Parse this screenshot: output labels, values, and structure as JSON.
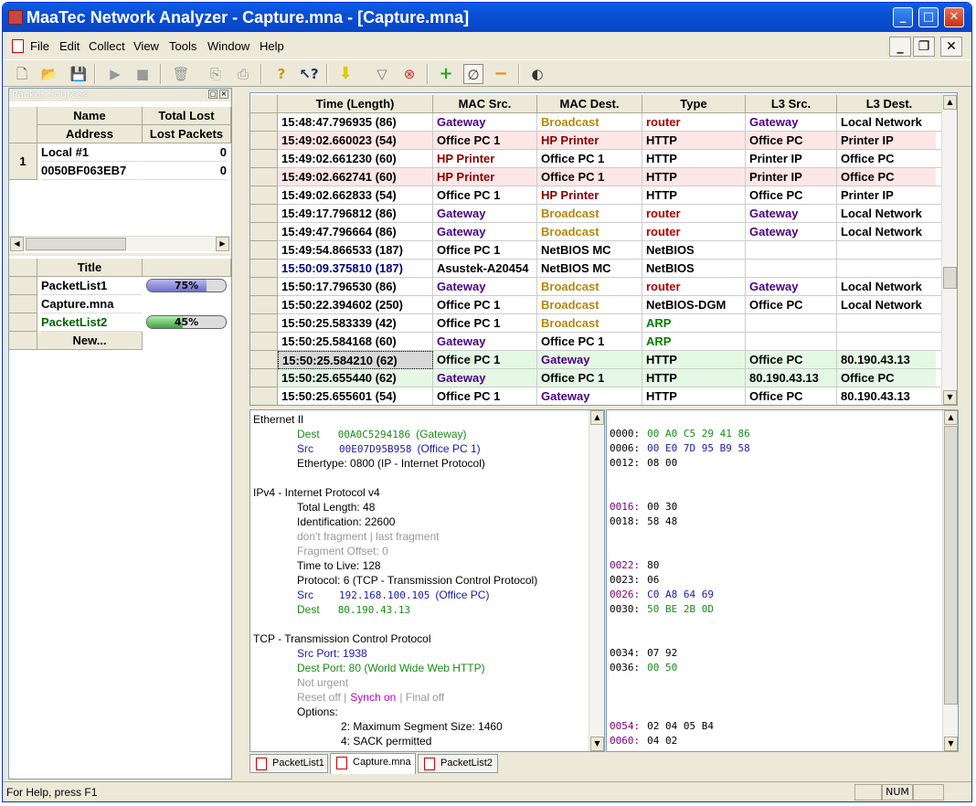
{
  "window": {
    "title": "MaaTec Network Analyzer - Capture.mna - [Capture.mna]"
  },
  "menu": [
    "File",
    "Edit",
    "Collect",
    "View",
    "Tools",
    "Window",
    "Help"
  ],
  "packet_sources": {
    "title": "Packet Sources",
    "headers": {
      "name": "Name",
      "total_lost": "Total Lost",
      "address": "Address",
      "lost_packets": "Lost Packets"
    },
    "row_number": "1",
    "name": "Local #1",
    "total_lost": "0",
    "address": "0050BF063EB7",
    "lost_packets": "0"
  },
  "lists": {
    "header": "Title",
    "items": [
      {
        "title": "PacketList1",
        "percent": "75%",
        "progress": 0.75,
        "color": "#000000"
      },
      {
        "title": "Capture.mna",
        "percent": "",
        "progress": null,
        "color": "#000000"
      },
      {
        "title": "PacketList2",
        "percent": "45%",
        "progress": 0.45,
        "color": "#006400"
      }
    ],
    "new_label": "New..."
  },
  "packet_table": {
    "headers": [
      "Time  (Length)",
      "MAC Src.",
      "MAC Dest.",
      "Type",
      "L3 Src.",
      "L3 Dest."
    ],
    "rows": [
      {
        "time": "15:48:47.796935  (86)",
        "mac_src": "Gateway",
        "mac_dst": "Broadcast",
        "type": "router",
        "l3_src": "Gateway",
        "l3_dst": "Local Network",
        "bg": "#ffffff"
      },
      {
        "time": "15:49:02.660023  (54)",
        "mac_src": "Office PC 1",
        "mac_dst": "HP Printer",
        "type": "HTTP",
        "l3_src": "Office PC",
        "l3_dst": "Printer IP",
        "bg": "#fde6e6"
      },
      {
        "time": "15:49:02.661230  (60)",
        "mac_src": "HP Printer",
        "mac_dst": "Office PC 1",
        "type": "HTTP",
        "l3_src": "Printer IP",
        "l3_dst": "Office PC",
        "bg": "#ffffff"
      },
      {
        "time": "15:49:02.662741  (60)",
        "mac_src": "HP Printer",
        "mac_dst": "Office PC 1",
        "type": "HTTP",
        "l3_src": "Printer IP",
        "l3_dst": "Office PC",
        "bg": "#fde6e6"
      },
      {
        "time": "15:49:02.662833  (54)",
        "mac_src": "Office PC 1",
        "mac_dst": "HP Printer",
        "type": "HTTP",
        "l3_src": "Office PC",
        "l3_dst": "Printer IP",
        "bg": "#ffffff"
      },
      {
        "time": "15:49:17.796812  (86)",
        "mac_src": "Gateway",
        "mac_dst": "Broadcast",
        "type": "router",
        "l3_src": "Gateway",
        "l3_dst": "Local Network",
        "bg": "#ffffff"
      },
      {
        "time": "15:49:47.796664  (86)",
        "mac_src": "Gateway",
        "mac_dst": "Broadcast",
        "type": "router",
        "l3_src": "Gateway",
        "l3_dst": "Local Network",
        "bg": "#ffffff"
      },
      {
        "time": "15:49:54.866533  (187)",
        "mac_src": "Office PC 1",
        "mac_dst": "NetBIOS MC",
        "type": "NetBIOS",
        "l3_src": "",
        "l3_dst": "",
        "bg": "#ffffff"
      },
      {
        "time": "15:50:09.375810  (187)",
        "mac_src": "Asustek-A20454",
        "mac_dst": "NetBIOS MC",
        "type": "NetBIOS",
        "l3_src": "",
        "l3_dst": "",
        "bg": "#ffffff"
      },
      {
        "time": "15:50:17.796530  (86)",
        "mac_src": "Gateway",
        "mac_dst": "Broadcast",
        "type": "router",
        "l3_src": "Gateway",
        "l3_dst": "Local Network",
        "bg": "#ffffff"
      },
      {
        "time": "15:50:22.394602  (250)",
        "mac_src": "Office PC 1",
        "mac_dst": "Broadcast",
        "type": "NetBIOS-DGM",
        "l3_src": "Office PC",
        "l3_dst": "Local Network",
        "bg": "#ffffff"
      },
      {
        "time": "15:50:25.583339  (42)",
        "mac_src": "Office PC 1",
        "mac_dst": "Broadcast",
        "type": "ARP",
        "l3_src": "",
        "l3_dst": "",
        "bg": "#ffffff"
      },
      {
        "time": "15:50:25.584168  (60)",
        "mac_src": "Gateway",
        "mac_dst": "Office PC 1",
        "type": "ARP",
        "l3_src": "",
        "l3_dst": "",
        "bg": "#ffffff"
      },
      {
        "time": "15:50:25.584210  (62)",
        "mac_src": "Office PC 1",
        "mac_dst": "Gateway",
        "type": "HTTP",
        "l3_src": "Office PC",
        "l3_dst": "80.190.43.13",
        "bg": "#e4f8e4"
      },
      {
        "time": "15:50:25.655440  (62)",
        "mac_src": "Gateway",
        "mac_dst": "Office PC 1",
        "type": "HTTP",
        "l3_src": "80.190.43.13",
        "l3_dst": "Office PC",
        "bg": "#e4f8e4"
      },
      {
        "time": "15:50:25.655601  (54)",
        "mac_src": "Office PC 1",
        "mac_dst": "Gateway",
        "type": "HTTP",
        "l3_src": "Office PC",
        "l3_dst": "80.190.43.13",
        "bg": "#ffffff"
      }
    ]
  },
  "colors": {
    "gateway": "#4b0082",
    "broadcast": "#b8860b",
    "router": "#b00000",
    "hp_printer": "#8b0000",
    "arp": "#008000",
    "blue_time": "#000080",
    "detail_green": "#1a8c1a",
    "detail_blue": "#1a1ab0",
    "detail_gray": "#999999",
    "detail_magenta": "#c000c0",
    "hex_purple": "#800080"
  },
  "detail": {
    "lines": [
      {
        "text": "Ethernet II",
        "indent": 0,
        "color": "#000000"
      },
      {
        "text": "Dest",
        "indent": 1,
        "color": "#1a8c1a",
        "mono": "00A0C5294186",
        "note": "(Gateway)"
      },
      {
        "text": "Src",
        "indent": 1,
        "color": "#1a1ab0",
        "mono": "00E07D95B958",
        "note": "(Office PC 1)"
      },
      {
        "text": "Ethertype:  0800  (IP - Internet Protocol)",
        "indent": 1,
        "color": "#000000"
      },
      {
        "text": "",
        "indent": 0,
        "color": "#000000"
      },
      {
        "text": "IPv4 - Internet Protocol v4",
        "indent": 0,
        "color": "#000000"
      },
      {
        "text": "Total Length:  48",
        "indent": 1,
        "color": "#000000"
      },
      {
        "text": "Identification:  22600",
        "indent": 1,
        "color": "#000000"
      },
      {
        "text": "don't fragment | last fragment",
        "indent": 1,
        "color": "#999999"
      },
      {
        "text": "Fragment Offset:  0",
        "indent": 1,
        "color": "#999999"
      },
      {
        "text": "Time to Live:  128",
        "indent": 1,
        "color": "#000000"
      },
      {
        "text": "Protocol:  6  (TCP - Transmission Control Protocol)",
        "indent": 1,
        "color": "#000000"
      },
      {
        "text": "Src",
        "indent": 1,
        "color": "#1a1ab0",
        "mono": "192.168.100.105",
        "note": "(Office PC)"
      },
      {
        "text": "Dest",
        "indent": 1,
        "color": "#1a8c1a",
        "mono": "80.190.43.13",
        "note": ""
      },
      {
        "text": "",
        "indent": 0,
        "color": "#000000"
      },
      {
        "text": "TCP - Transmission Control Protocol",
        "indent": 0,
        "color": "#000000"
      },
      {
        "text": "Src Port:  1938",
        "indent": 1,
        "color": "#1a1ab0"
      },
      {
        "text": "Dest Port:  80  (World Wide Web HTTP)",
        "indent": 1,
        "color": "#1a8c1a"
      },
      {
        "text": "Not urgent",
        "indent": 1,
        "color": "#999999"
      },
      {
        "text": "Reset off |",
        "indent": 1,
        "color": "#999999",
        "extra": "Synch on",
        "extra2": "| Final off"
      },
      {
        "text": "Options:",
        "indent": 1,
        "color": "#000000"
      },
      {
        "text": "2:  Maximum Segment Size:  1460",
        "indent": 2,
        "color": "#000000"
      },
      {
        "text": "4:  SACK permitted",
        "indent": 2,
        "color": "#000000"
      }
    ]
  },
  "hex": {
    "lines": [
      {
        "row": 1,
        "offset": "0000:",
        "bytes": "00 A0 C5 29 41 86",
        "oc": "#000000",
        "bc": "#1a8c1a"
      },
      {
        "row": 2,
        "offset": "0006:",
        "bytes": "00 E0 7D 95 B9 58",
        "oc": "#000000",
        "bc": "#1a1ab0"
      },
      {
        "row": 3,
        "offset": "0012:",
        "bytes": "08 00",
        "oc": "#000000",
        "bc": "#000000"
      },
      {
        "row": 6,
        "offset": "0016:",
        "bytes": "00 30",
        "oc": "#800080",
        "bc": "#000000"
      },
      {
        "row": 7,
        "offset": "0018:",
        "bytes": "58 48",
        "oc": "#000000",
        "bc": "#000000"
      },
      {
        "row": 10,
        "offset": "0022:",
        "bytes": "80",
        "oc": "#800080",
        "bc": "#000000"
      },
      {
        "row": 11,
        "offset": "0023:",
        "bytes": "06",
        "oc": "#000000",
        "bc": "#000000"
      },
      {
        "row": 12,
        "offset": "0026:",
        "bytes": "C0 A8 64 69",
        "oc": "#800080",
        "bc": "#1a1ab0"
      },
      {
        "row": 13,
        "offset": "0030:",
        "bytes": "50 BE 2B 0D",
        "oc": "#000000",
        "bc": "#1a8c1a"
      },
      {
        "row": 16,
        "offset": "0034:",
        "bytes": "07 92",
        "oc": "#000000",
        "bc": "#000000"
      },
      {
        "row": 17,
        "offset": "0036:",
        "bytes": "00 50",
        "oc": "#000000",
        "bc": "#1a8c1a"
      },
      {
        "row": 21,
        "offset": "0054:",
        "bytes": "02 04 05 B4",
        "oc": "#800080",
        "bc": "#000000"
      },
      {
        "row": 22,
        "offset": "0060:",
        "bytes": "04 02",
        "oc": "#800080",
        "bc": "#000000"
      }
    ]
  },
  "tabs": [
    "PacketList1",
    "Capture.mna",
    "PacketList2"
  ],
  "status": {
    "text": "For Help, press F1",
    "num": "NUM"
  }
}
